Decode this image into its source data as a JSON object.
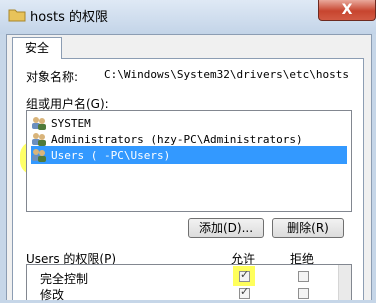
{
  "window": {
    "title": "hosts 的权限",
    "close_label": "X"
  },
  "tabs": [
    {
      "label": "安全"
    }
  ],
  "object": {
    "label": "对象名称:",
    "path": "C:\\Windows\\System32\\drivers\\etc\\hosts"
  },
  "groups": {
    "label": "组或用户名(G):",
    "items": [
      {
        "label": "SYSTEM",
        "icon": "users-icon"
      },
      {
        "label": "Administrators (hzy-PC\\Administrators)",
        "icon": "users-icon"
      },
      {
        "label": "Users (    -PC\\Users)",
        "icon": "users-icon",
        "selected": true
      }
    ]
  },
  "buttons": {
    "add": "添加(D)...",
    "remove": "删除(R)"
  },
  "permissions": {
    "label": "Users 的权限(P)",
    "allow_header": "允许",
    "deny_header": "拒绝",
    "rows": [
      {
        "name": "完全控制",
        "allow": true,
        "deny": false
      },
      {
        "name": "修改",
        "allow": true,
        "deny": false
      }
    ]
  },
  "colors": {
    "selection": "#3399ff",
    "highlight": "#ffff33",
    "close": "#c7452f"
  }
}
